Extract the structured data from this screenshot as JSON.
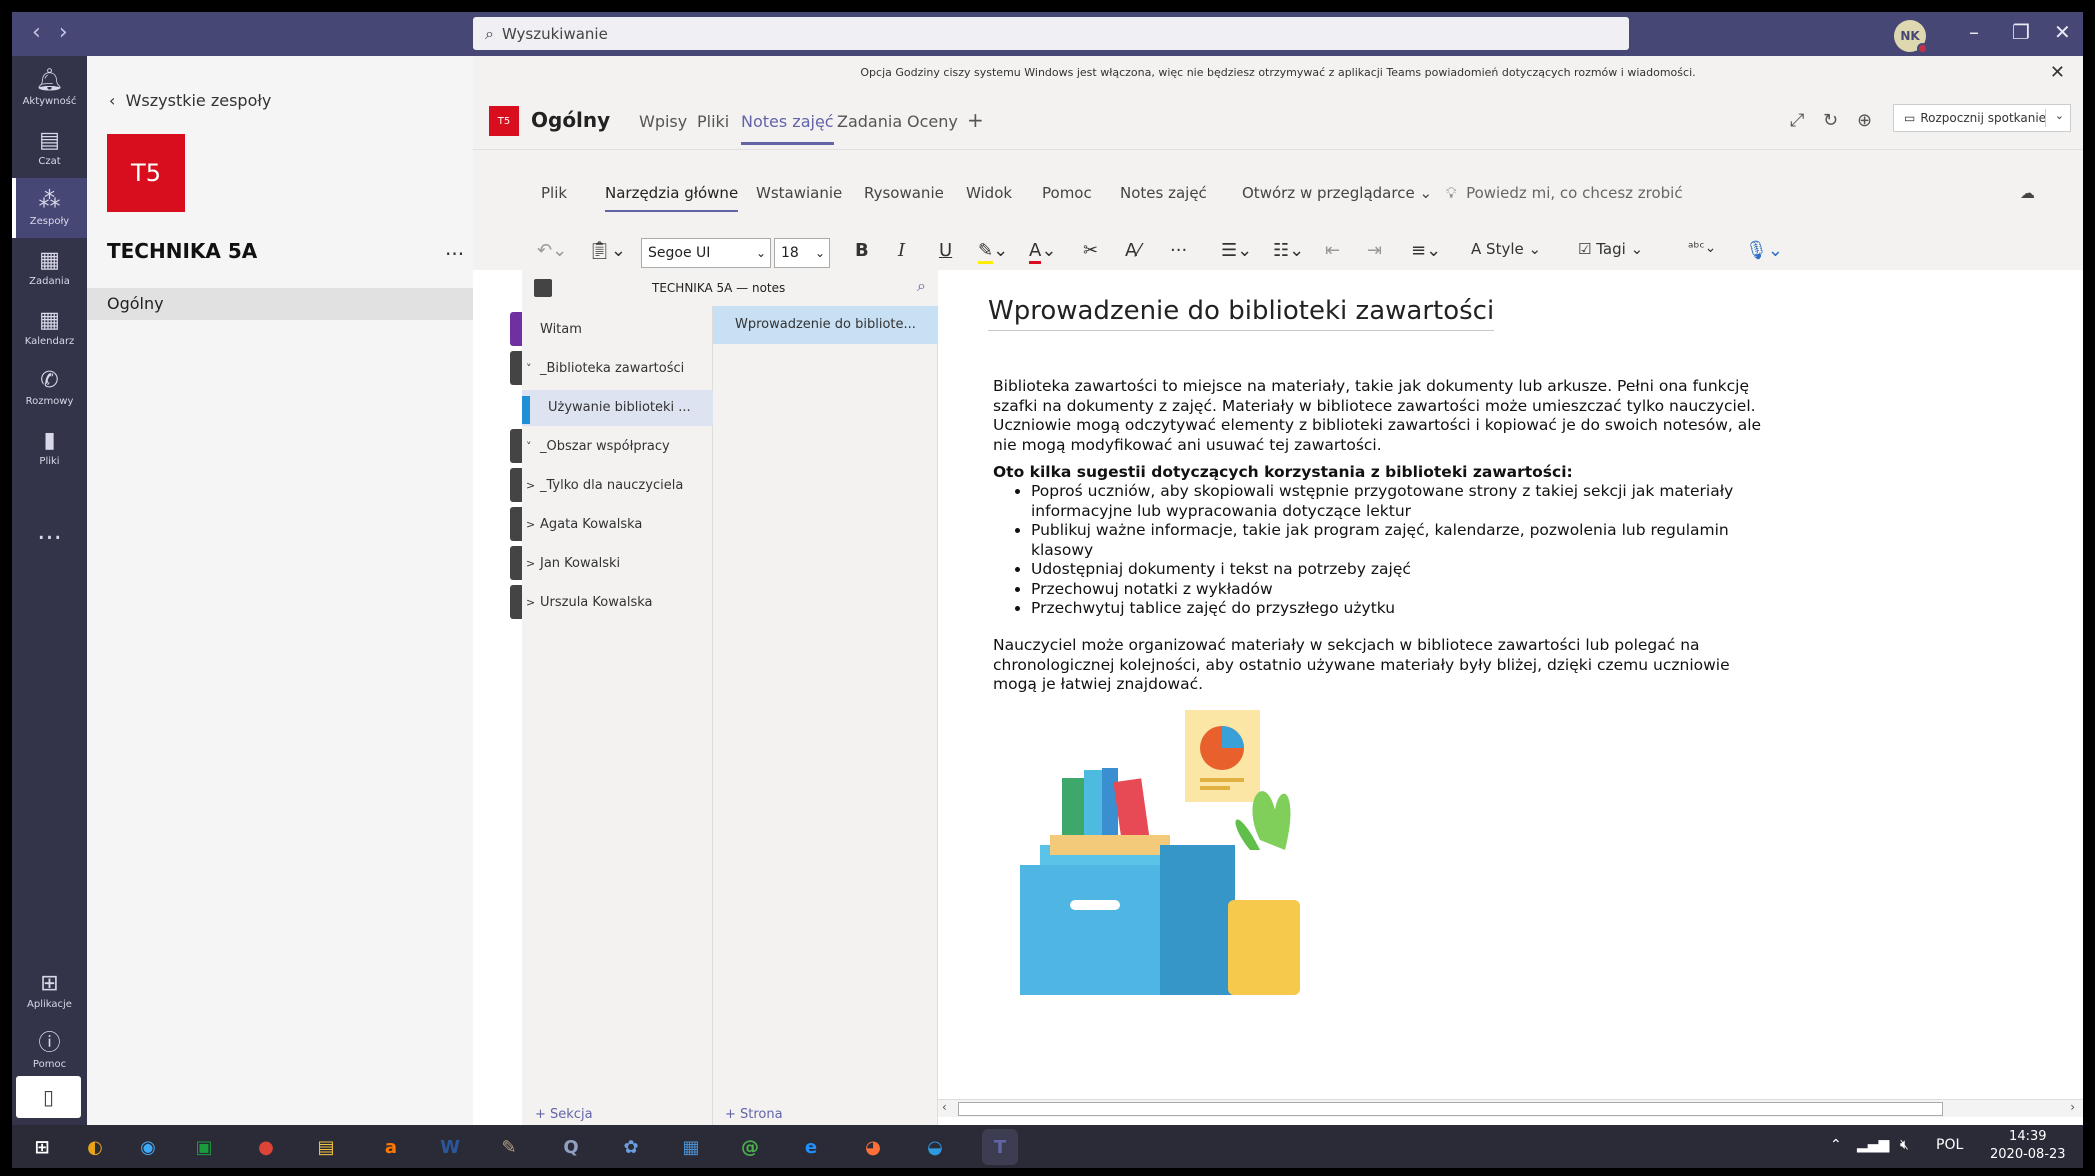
{
  "titlebar": {
    "search_placeholder": "Wyszukiwanie",
    "avatar_initials": "NK",
    "nav_icons": [
      "chevron-left-icon",
      "chevron-right-icon"
    ],
    "window_controls": [
      "minimize-icon",
      "restore-icon",
      "close-icon"
    ]
  },
  "rail": {
    "items": [
      {
        "label": "Aktywność",
        "icon": "bell-icon"
      },
      {
        "label": "Czat",
        "icon": "chat-icon"
      },
      {
        "label": "Zespoły",
        "icon": "teams-icon",
        "active": true
      },
      {
        "label": "Zadania",
        "icon": "assignments-icon"
      },
      {
        "label": "Kalendarz",
        "icon": "calendar-icon"
      },
      {
        "label": "Rozmowy",
        "icon": "phone-icon"
      },
      {
        "label": "Pliki",
        "icon": "files-icon"
      }
    ],
    "more": "...",
    "bottom": [
      {
        "label": "Aplikacje",
        "icon": "apps-icon"
      },
      {
        "label": "Pomoc",
        "icon": "help-icon"
      }
    ]
  },
  "team": {
    "back_label": "Wszystkie zespoły",
    "tile": "T5",
    "name": "TECHNIKA 5A",
    "more": "...",
    "channel": "Ogólny",
    "tile_color": "#d80e1e"
  },
  "notification": "Opcja Godziny ciszy systemu Windows jest włączona, więc nie będziesz otrzymywać z aplikacji Teams powiadomień dotyczących rozmów i wiadomości.",
  "channel": {
    "icon": "T5",
    "name": "Ogólny",
    "tabs": [
      "Wpisy",
      "Pliki",
      "Notes zajęć",
      "Zadania",
      "Oceny"
    ],
    "active_tab": "Notes zajęć",
    "meet_label": "Rozpocznij spotkanie",
    "accent": "#6264a7"
  },
  "ribbon": {
    "tabs": [
      "Plik",
      "Narzędzia główne",
      "Wstawianie",
      "Rysowanie",
      "Widok",
      "Pomoc",
      "Notes zajęć"
    ],
    "open_in_browser": "Otwórz w przeglądarce",
    "tell_me": "Powiedz mi, co chcesz zrobić",
    "font": "Segoe UI",
    "font_size": "18",
    "style_label": "Style",
    "tags_label": "Tagi"
  },
  "notebook": {
    "title": "TECHNIKA 5A — notes",
    "sections": [
      {
        "label": "Witam",
        "chevron": "",
        "color": "#7030a0"
      },
      {
        "label": "_Biblioteka zawartości",
        "chevron": "˅",
        "color": "#444"
      },
      {
        "label": "Używanie biblioteki ...",
        "chevron": "",
        "color": "#1e90d8",
        "indent": true,
        "active": true
      },
      {
        "label": "_Obszar współpracy",
        "chevron": "˅",
        "color": "#444"
      },
      {
        "label": "_Tylko dla nauczyciela",
        "chevron": ">",
        "color": "#444"
      },
      {
        "label": "Agata Kowalska",
        "chevron": ">",
        "color": "#444"
      },
      {
        "label": "Jan Kowalski",
        "chevron": ">",
        "color": "#444"
      },
      {
        "label": "Urszula Kowalska",
        "chevron": ">",
        "color": "#444"
      }
    ],
    "pages": [
      "Wprowadzenie do bibliote..."
    ],
    "add_section": "+ Sekcja",
    "add_page": "+ Strona"
  },
  "page": {
    "title": "Wprowadzenie do biblioteki zawartości",
    "para1": "Biblioteka zawartości to miejsce na materiały, takie jak dokumenty lub arkusze. Pełni ona funkcję szafki na dokumenty z zajęć. Materiały w bibliotece zawartości może umieszczać tylko nauczyciel. Uczniowie mogą odczytywać elementy z biblioteki zawartości i kopiować je do swoich notesów, ale nie mogą modyfikować ani usuwać tej zawartości.",
    "tips_heading": "Oto kilka sugestii dotyczących korzystania z biblioteki zawartości:",
    "tips": [
      "Poproś uczniów, aby skopiowali wstępnie przygotowane strony z takiej sekcji jak materiały informacyjne lub wypracowania dotyczące lektur",
      "Publikuj ważne informacje, takie jak program zajęć, kalendarze, pozwolenia lub regulamin klasowy",
      "Udostępniaj dokumenty i tekst na potrzeby zajęć",
      "Przechowuj notatki z wykładów",
      "Przechwytuj tablice zajęć do przyszłego użytku"
    ],
    "para2": "Nauczyciel może organizować materiały w sekcjach w bibliotece zawartości lub polegać na chronologicznej kolejności, aby ostatnio używane materiały były bliżej, dzięki czemu uczniowie mogą je łatwiej znajdować."
  },
  "taskbar": {
    "apps": [
      {
        "name": "windows-start-icon",
        "glyph": "⊞",
        "color": "#ffffff"
      },
      {
        "name": "chrome-like-icon",
        "glyph": "◐",
        "color": "#e8a317"
      },
      {
        "name": "media-icon",
        "glyph": "◉",
        "color": "#3fa9f5"
      },
      {
        "name": "store-icon",
        "glyph": "▣",
        "color": "#1a9c3e"
      },
      {
        "name": "chrome-icon",
        "glyph": "●",
        "color": "#db4437"
      },
      {
        "name": "file-explorer-icon",
        "glyph": "▤",
        "color": "#f4c542"
      },
      {
        "name": "avast-icon",
        "glyph": "a",
        "color": "#ff7800"
      },
      {
        "name": "word-icon",
        "glyph": "W",
        "color": "#2b579a"
      },
      {
        "name": "paint-tool-icon",
        "glyph": "✎",
        "color": "#b0a080"
      },
      {
        "name": "app-q-icon",
        "glyph": "Q",
        "color": "#8fa0c0"
      },
      {
        "name": "paint-icon",
        "glyph": "✿",
        "color": "#6aa0e0"
      },
      {
        "name": "control-panel-icon",
        "glyph": "▦",
        "color": "#4a90d0"
      },
      {
        "name": "mail-icon",
        "glyph": "@",
        "color": "#4ab04a"
      },
      {
        "name": "ie-icon",
        "glyph": "e",
        "color": "#1e90ff"
      },
      {
        "name": "firefox-icon",
        "glyph": "◕",
        "color": "#ff7139"
      },
      {
        "name": "edge-icon",
        "glyph": "◒",
        "color": "#2d9ae0"
      },
      {
        "name": "teams-icon",
        "glyph": "T",
        "color": "#6264a7"
      }
    ],
    "lang": "POL",
    "time": "14:39",
    "date": "2020-08-23"
  }
}
